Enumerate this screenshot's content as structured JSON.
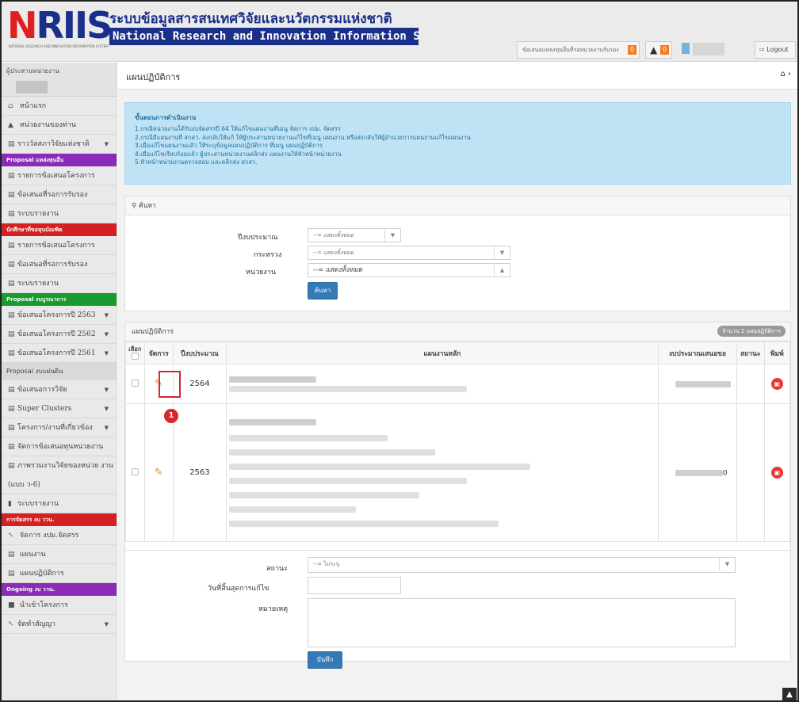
{
  "header": {
    "logo_text_n": "N",
    "logo_text_ris": "RIIS",
    "logo_tagline": "NATIONAL RESEARCH AND INNOVATION INFORMATION SYSTEM",
    "title_th": "ระบบข้อมูลสารสนเทศวิจัยและนวัตกรรมแห่งชาติ",
    "title_en": "National Research and Innovation Information System",
    "proposal_label": "ข้อเสนอแหล่งทุนอื่นที่รอหน่วยงานรับรอง",
    "proposal_badge": "0",
    "notify_badge": "0",
    "logout_label": "Logout"
  },
  "sidebar": {
    "user_title": "ผู้ประสานหน่วยงาน",
    "items_top": [
      {
        "label": "หน้าแรก",
        "icon": "home-icon"
      },
      {
        "label": "หน่วยงานของท่าน",
        "icon": "university-icon"
      },
      {
        "label": "ราววัลสภาวิจัยแห่งชาติ",
        "icon": "list-icon"
      }
    ],
    "sec_proposal_fund": "Proposal แหล่งทุนอื่น",
    "items_fund": [
      "รายการข้อเสนอโครงการ",
      "ข้อเสนอที่รอการรับรอง",
      "ระบบรายงาน"
    ],
    "sec_students": "นักศึกษาที่ขอทุนบัณฑิต",
    "items_students": [
      "รายการข้อเสนอโครงการ",
      "ข้อเสนอที่รอการรับรอง",
      "ระบบรายงาน"
    ],
    "sec_proposal_budget": "Proposal งบบูรณาการ",
    "items_budget": [
      "ข้อเสนอโครงการปี 2563",
      "ข้อเสนอโครงการปี 2562",
      "ข้อเสนอโครงการปี 2561"
    ],
    "sec_proposal_plan": "Proposal งบแผ่นดิน",
    "items_plan": [
      "ข้อเสนอการวิจัย",
      "Super Clusters",
      "โครงการ/งานที่เกี่ยวข้อง",
      "จัดการข้อเสนอทุนหน่วยงาน",
      "ภาพรวมงานวิจัยของหน่วย งาน (แบบ ว-6)",
      "ระบบรายงาน"
    ],
    "sec_allocation": "การจัดสรร งบ ววน.",
    "items_allocation": [
      "จัดการ งปม.จัดสรร",
      "แผนงาน",
      "แผนปฏิบัติการ"
    ],
    "sec_ongoing": "Ongoing งบ ววน.",
    "items_ongoing": [
      "นำเข้าโครงการ",
      "จัดทำสัญญา"
    ]
  },
  "page": {
    "title": "แผนปฏิบัติการ",
    "home_icon": "home-icon"
  },
  "steps": {
    "heading": "ขั้นตอนการดำเนินงาน",
    "lines": [
      "1.กรณีหน่วยงานได้รับงบจัดสรรปี 64 ให้แก้ไขแผนงานที่เมนู จัดการ งปม. จัดสรร",
      "2.กรณีมีแผนงานที่ สกสว. ส่งกลับให้แก้ ให้ผู้ประสานหน่วยงานแก้ไขที่เมนู แผนงาน หรือส่งกลับให้ผู้อำนวยการแผนงานแก้ไขแผนงาน",
      "3.เมื่อแก้ไขแผนงานแล้ว ให้ระบุข้อมูลแผนปฏิบัติการ ที่เมนู แผนปฏิบัติการ",
      "4.เมื่อแก้ไขเรียบร้อยแล้ว ผู้ประสานหน่วยงานคลิกส่ง แผนงานให้หัวหน้าหน่วยงาน",
      "5.หัวหน้าหน่วยงานตรวจสอบ และคลิกส่ง สกสว."
    ]
  },
  "search": {
    "heading": "ค้นหา",
    "year_label": "ปีงบประมาณ",
    "year_value": "--= แสดงทั้งหมด",
    "ministry_label": "กระทรวง",
    "ministry_value": "--= แสดงทั้งหมด",
    "agency_label": "หน่วยงาน",
    "agency_value": "--= แสดงทั้งหมด",
    "search_button": "ค้นหา"
  },
  "plan": {
    "heading": "แผนปฏิบัติการ",
    "count": "จำนวน 2 แผนปฏิบัติการ",
    "columns": [
      "เลือก",
      "จัดการ",
      "ปีงบประมาณ",
      "แผนงานหลัก",
      "งบประมาณเสนอขอ",
      "สถานะ",
      "พิมพ์"
    ],
    "rows": [
      {
        "year": "2564",
        "amount_suffix": ""
      },
      {
        "year": "2563",
        "amount_suffix": "0"
      }
    ],
    "marker": "1"
  },
  "form": {
    "status_label": "สถานะ",
    "status_value": "--= ไม่ระบุ",
    "deadline_label": "วันที่สิ้นสุดการแก้ไข",
    "remark_label": "หมายเหตุ",
    "save_button": "บันทึก"
  }
}
